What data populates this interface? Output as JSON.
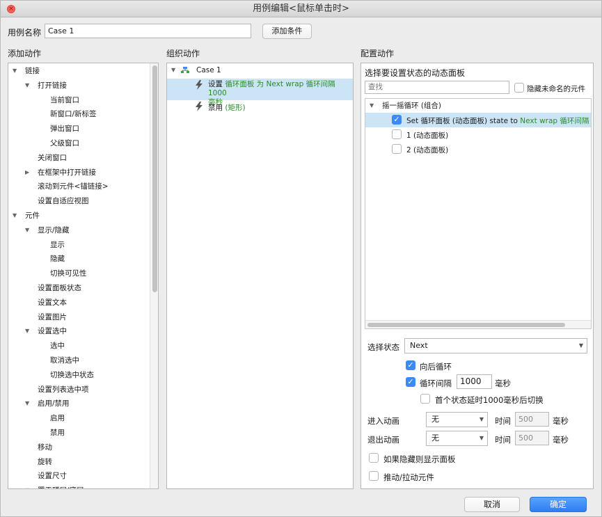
{
  "window": {
    "title": "用例编辑<鼠标单击时>",
    "close": "×"
  },
  "case_name": {
    "label": "用例名称",
    "value": "Case 1"
  },
  "add_condition_label": "添加条件",
  "add_action": {
    "heading": "添加动作",
    "items": [
      {
        "label": "链接",
        "expanded": true
      },
      {
        "label": "打开链接",
        "expanded": true
      },
      {
        "label": "当前窗口"
      },
      {
        "label": "新窗口/新标签"
      },
      {
        "label": "弹出窗口"
      },
      {
        "label": "父级窗口"
      },
      {
        "label": "关闭窗口"
      },
      {
        "label": "在框架中打开链接",
        "expanded": false
      },
      {
        "label": "滚动到元件<锚链接>"
      },
      {
        "label": "设置自适应视图"
      },
      {
        "label": "元件",
        "expanded": true
      },
      {
        "label": "显示/隐藏",
        "expanded": true
      },
      {
        "label": "显示"
      },
      {
        "label": "隐藏"
      },
      {
        "label": "切换可见性"
      },
      {
        "label": "设置面板状态"
      },
      {
        "label": "设置文本"
      },
      {
        "label": "设置图片"
      },
      {
        "label": "设置选中",
        "expanded": true
      },
      {
        "label": "选中"
      },
      {
        "label": "取消选中"
      },
      {
        "label": "切换选中状态"
      },
      {
        "label": "设置列表选中项"
      },
      {
        "label": "启用/禁用",
        "expanded": true
      },
      {
        "label": "启用"
      },
      {
        "label": "禁用"
      },
      {
        "label": "移动"
      },
      {
        "label": "旋转"
      },
      {
        "label": "设置尺寸"
      },
      {
        "label": "置于顶层/底层",
        "expanded": true
      }
    ]
  },
  "organize": {
    "heading": "组织动作",
    "case_label": "Case 1",
    "actions": [
      {
        "verb": "设置",
        "target": "循环面板 为 Next wrap 循环间隔 1000",
        "target2": "毫秒"
      },
      {
        "verb": "禁用",
        "target": "(矩形)"
      }
    ]
  },
  "config": {
    "heading": "配置动作",
    "subheading": "选择要设置状态的动态面板",
    "search_placeholder": "查找",
    "hide_unnamed_label": "隐藏未命名的元件",
    "hide_unnamed_checked": false,
    "group_label": "摇一摇循环 (组合)",
    "items": [
      {
        "text": "Set 循环面板 (动态面板) state to ",
        "extra": "Next wrap 循环间隔 1000",
        "checked": true
      },
      {
        "text": "1 (动态面板)",
        "extra": "",
        "checked": false
      },
      {
        "text": "2 (动态面板)",
        "extra": "",
        "checked": false
      }
    ],
    "select_state_label": "选择状态",
    "select_state_value": "Next",
    "wrap_label": "向后循环",
    "wrap_checked": true,
    "interval_label": "循环间隔",
    "interval_checked": true,
    "interval_value": "1000",
    "interval_unit": "毫秒",
    "first_delay_label": "首个状态延时1000毫秒后切换",
    "first_delay_checked": false,
    "enter_anim_label": "进入动画",
    "enter_anim_value": "无",
    "exit_anim_label": "退出动画",
    "exit_anim_value": "无",
    "time_label": "时间",
    "enter_time": "500",
    "exit_time": "500",
    "ms_unit": "毫秒",
    "show_if_hidden_label": "如果隐藏则显示面板",
    "push_pull_label": "推动/拉动元件"
  },
  "footer": {
    "cancel": "取消",
    "ok": "确定"
  },
  "colors": {
    "accent": "#3d8af7",
    "selection": "#cbe4f6",
    "green_text": "#2a8a2a"
  },
  "icons": {
    "case": "case-icon",
    "action": "lightning-icon"
  }
}
